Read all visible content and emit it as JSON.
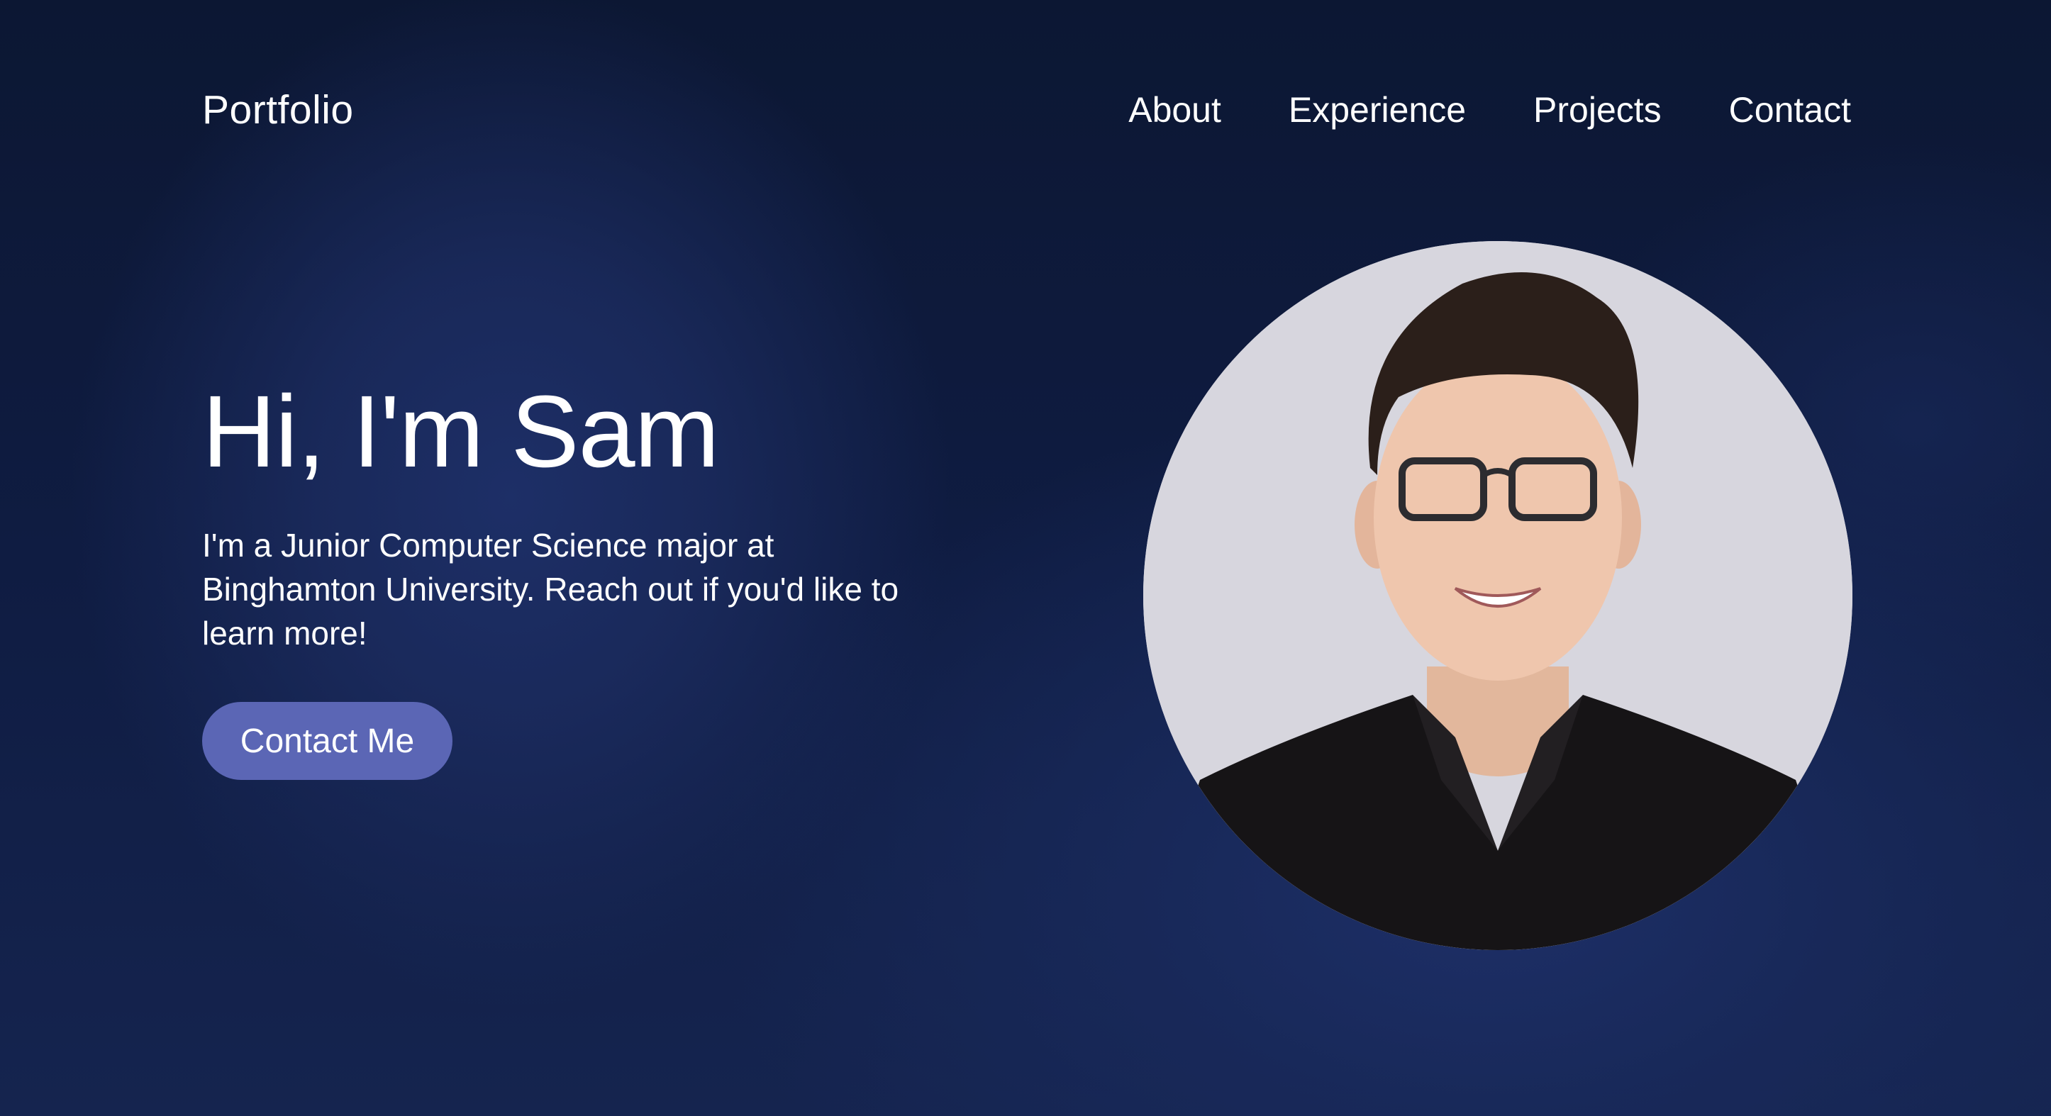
{
  "nav": {
    "logo": "Portfolio",
    "links": [
      {
        "label": "About"
      },
      {
        "label": "Experience"
      },
      {
        "label": "Projects"
      },
      {
        "label": "Contact"
      }
    ]
  },
  "hero": {
    "title": "Hi, I'm Sam",
    "subtitle": "I'm a Junior Computer Science major at Binghamton University. Reach out if you'd like to learn more!",
    "cta_label": "Contact Me"
  },
  "colors": {
    "background": "#0a1430",
    "accent": "#5b66b5",
    "text": "#ffffff"
  }
}
